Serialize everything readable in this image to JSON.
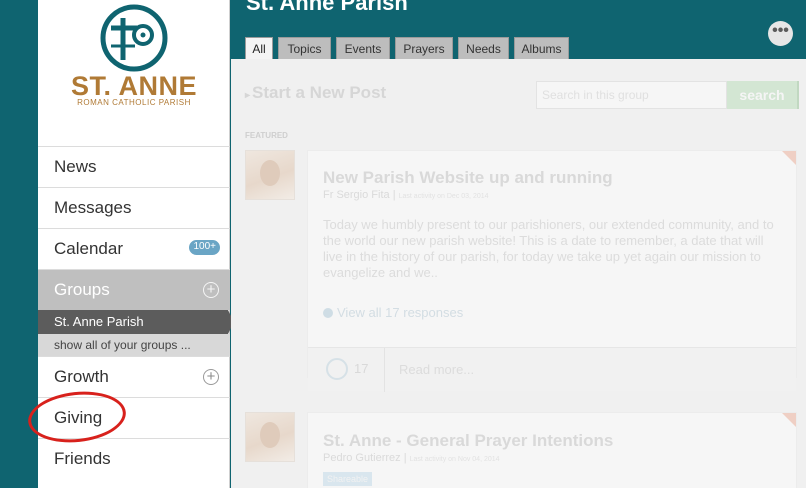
{
  "brand": {
    "name": "ST. ANNE",
    "subtitle": "ROMAN CATHOLIC PARISH",
    "color": "#b07a35",
    "logo_color": "#0f6470"
  },
  "sidebar": {
    "items": [
      {
        "label": "News"
      },
      {
        "label": "Messages"
      },
      {
        "label": "Calendar",
        "badge": "100+"
      },
      {
        "label": "Groups",
        "icon": "plus-circle-icon"
      },
      {
        "label": "Growth",
        "icon": "plus-circle-icon"
      },
      {
        "label": "Giving"
      },
      {
        "label": "Friends"
      }
    ],
    "groups_sub": {
      "active": "St. Anne Parish",
      "show_all": "show all of your groups ..."
    }
  },
  "header": {
    "title": "St. Anne Parish",
    "more_icon": "ellipsis-icon"
  },
  "tabs": [
    {
      "label": "All",
      "active": true
    },
    {
      "label": "Topics"
    },
    {
      "label": "Events"
    },
    {
      "label": "Prayers"
    },
    {
      "label": "Needs"
    },
    {
      "label": "Albums"
    }
  ],
  "content": {
    "start_post": "Start a New Post",
    "search": {
      "placeholder": "Search in this group",
      "button": "search"
    },
    "featured_label": "FEATURED",
    "posts": [
      {
        "title": "New Parish Website up and running",
        "author": "Fr Sergio Fita",
        "meta": "Last activity on Dec 03, 2014",
        "body": "Today we humbly present to our parishioners, our extended community, and to the world our new parish website! This is a date to remember, a date that will live in the history of our parish, for today we take up yet again our mission to evangelize and we..",
        "view_all": "View all 17 responses",
        "likes": "17",
        "read_more": "Read more..."
      },
      {
        "title": "St. Anne - General Prayer Intentions",
        "author": "Pedro Gutierrez",
        "meta": "Last activity on Nov 04, 2014",
        "tag": "Shareable"
      }
    ]
  },
  "annotation": {
    "target": "Giving",
    "color": "#d8211c"
  }
}
